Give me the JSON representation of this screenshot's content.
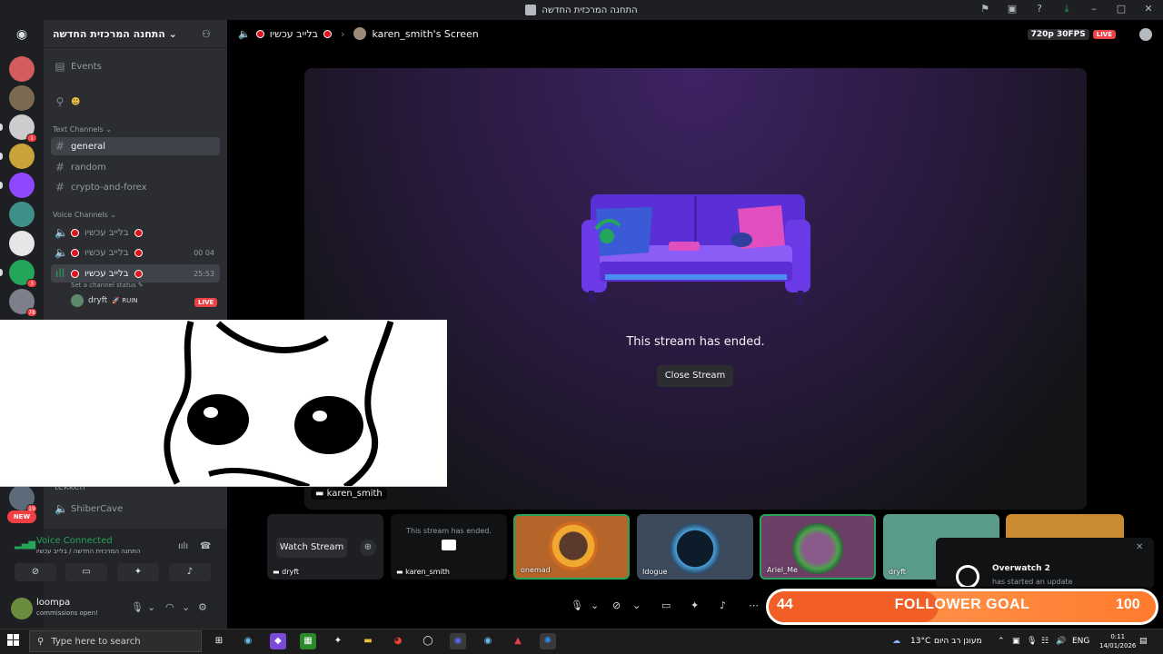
{
  "window": {
    "title": "התחנה המרכזית החדשה"
  },
  "server": {
    "name": "התחנה המרכזית החדשה"
  },
  "sidebar": {
    "events_label": "Events",
    "text_category": "Text Channels",
    "text_channels": [
      "general",
      "random",
      "crypto-and-forex"
    ],
    "voice_category": "Voice Channels",
    "voice_channels": [
      {
        "name": "בלייב עכשיו",
        "time": ""
      },
      {
        "name": "בלייב עכשיו",
        "time": "00 04"
      },
      {
        "name": "בלייב עכשיו",
        "time": "25:53"
      }
    ],
    "channel_status_placeholder": "Set a channel status",
    "streamer": {
      "name": "dryft",
      "game": "RUIN",
      "live": "LIVE"
    },
    "lower_channels": [
      "tekken",
      "ShiberCave"
    ],
    "new_badge": "NEW"
  },
  "voice": {
    "connected": "Voice Connected",
    "location": "התחנה המרכזית החדשה / בלייב עכשיו"
  },
  "user": {
    "name": "loompa",
    "status": "commissions open!"
  },
  "stage": {
    "channel": "בלייב עכשיו",
    "screen_title": "karen_smith's Screen",
    "quality": "720p 30FPS",
    "live": "LIVE",
    "ended_text": "This stream has ended.",
    "close_button": "Close Stream",
    "name_tag": "karen_smith"
  },
  "tiles": [
    {
      "name": "dryft",
      "button": "Watch Stream"
    },
    {
      "name": "karen_smith",
      "ended": "This stream has ended."
    },
    {
      "name": "onemad"
    },
    {
      "name": "Idogue"
    },
    {
      "name": "Ariel_Me"
    },
    {
      "name": "dryft"
    }
  ],
  "notification": {
    "title": "Overwatch 2",
    "body": "has started an update"
  },
  "goal": {
    "current": 44,
    "label": "FOLLOWER GOAL",
    "max": 100
  },
  "taskbar": {
    "search_placeholder": "Type here to search",
    "weather": "13°C",
    "weather_desc": "מעונן רב היום",
    "lang": "ENG",
    "time": "0:11",
    "date": "14/01/2026"
  },
  "colors": {
    "accent": "#5865f2",
    "live": "#ed4245",
    "online": "#23a55a",
    "goal": "#ff7b2e"
  }
}
